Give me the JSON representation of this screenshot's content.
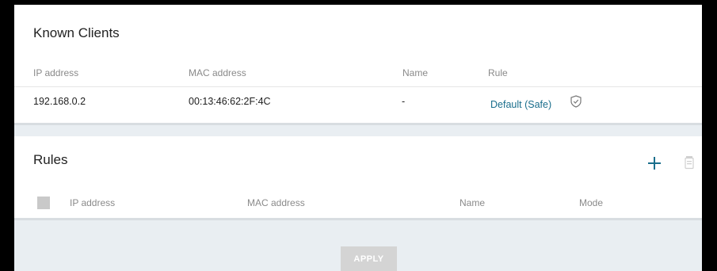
{
  "known_clients": {
    "title": "Known Clients",
    "columns": [
      "IP address",
      "MAC address",
      "Name",
      "Rule"
    ],
    "rows": [
      {
        "ip": "192.168.0.2",
        "mac": "00:13:46:62:2F:4C",
        "name": "-",
        "rule": "Default (Safe)",
        "rule_icon": "shield-icon"
      }
    ]
  },
  "rules": {
    "title": "Rules",
    "columns": [
      "IP address",
      "MAC address",
      "Name",
      "Mode"
    ],
    "add_icon": "plus-icon",
    "delete_icon": "trash-icon"
  },
  "apply_label": "APPLY",
  "colors": {
    "accent": "#1a6e8c",
    "background": "#e9eef2",
    "disabled": "#d4d4d4"
  }
}
